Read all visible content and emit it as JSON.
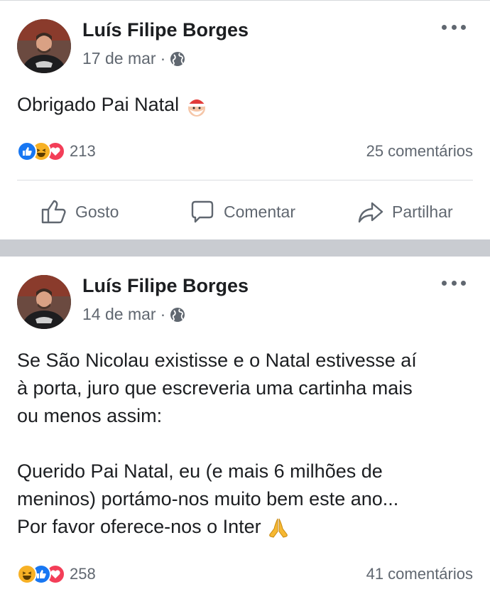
{
  "posts": [
    {
      "author": "Luís Filipe Borges",
      "date": "17 de mar",
      "privacy_icon": "globe-icon",
      "text_lines": [
        "Obrigado Pai Natal"
      ],
      "text_emoji": "santa-emoji",
      "reactions": [
        "like",
        "haha",
        "love"
      ],
      "reaction_count": "213",
      "comments": "25 comentários",
      "actions": {
        "like": "Gosto",
        "comment": "Comentar",
        "share": "Partilhar"
      }
    },
    {
      "author": "Luís Filipe Borges",
      "date": "14 de mar",
      "privacy_icon": "globe-icon",
      "paragraph1": [
        "Se São Nicolau existisse e o Natal estivesse aí",
        "à porta, juro que escreveria uma cartinha mais",
        "ou menos assim:"
      ],
      "paragraph2": [
        "Querido Pai Natal, eu (e mais 6 milhões de",
        "meninos) portámo-nos muito bem este ano...",
        "Por favor oferece-nos o Inter"
      ],
      "text_emoji": "folded-hands-emoji",
      "reactions": [
        "haha",
        "like",
        "love"
      ],
      "reaction_count": "258",
      "comments": "41 comentários"
    }
  ],
  "colors": {
    "like": "#1877f2",
    "love": "#f33e58",
    "haha": "#f7b125",
    "secondary_text": "#606770",
    "separator": "#c9ccd1"
  }
}
